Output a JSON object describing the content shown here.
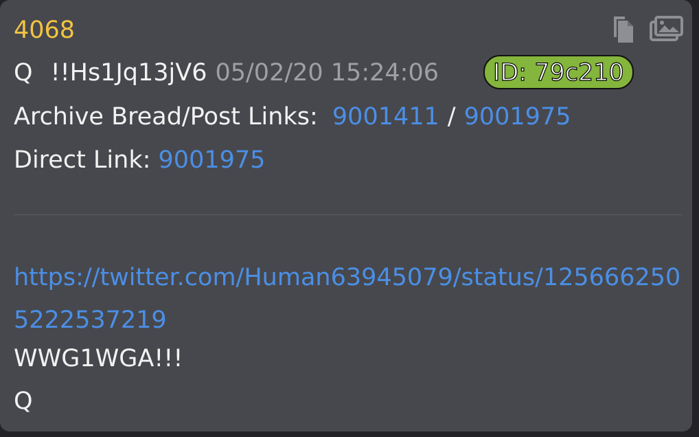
{
  "post": {
    "number": "4068",
    "author": "Q",
    "tripcode": "!!Hs1Jq13jV6",
    "timestamp": "05/02/20 15:24:06",
    "id_badge": "ID: 79c210",
    "id_badge_color": "#84b53c"
  },
  "links": {
    "archive_label": "Archive Bread/Post Links:",
    "archive_bread": "9001411",
    "separator": "/",
    "archive_post": "9001975",
    "direct_label": "Direct Link:",
    "direct_post": "9001975"
  },
  "body": {
    "url": "https://twitter.com/Human63945079/status/1256662505222537219",
    "line1": "WWG1WGA!!!",
    "line2": "Q"
  },
  "toolbar": {
    "copy_icon": "copy-icon",
    "images_icon": "images-icon"
  },
  "colors": {
    "card_bg": "#47484d",
    "post_number": "#f2c443",
    "link": "#4b8fe6",
    "timestamp": "#9ea0a6"
  }
}
